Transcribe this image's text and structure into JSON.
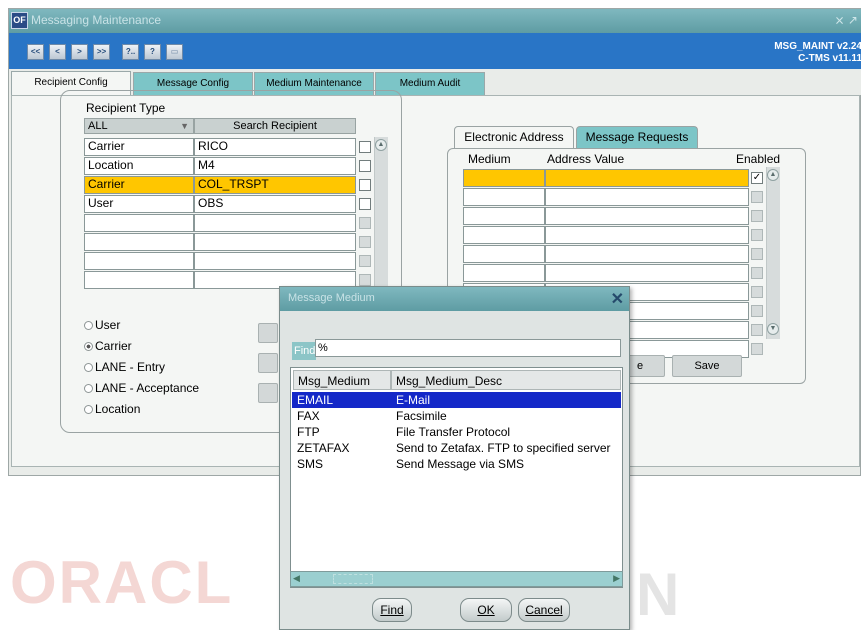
{
  "window": {
    "title": "Messaging Maintenance",
    "icon_label": "OF",
    "controls": "⨯ ↗"
  },
  "toolbar": {
    "buttons": [
      "<<",
      "<",
      ">",
      ">>",
      "?..",
      "?",
      "▭"
    ],
    "app_id": "MSG_MAINT v2.24",
    "version": "C-TMS v11.11"
  },
  "tabs": [
    "Recipient Config",
    "Message Config",
    "Medium Maintenance",
    "Medium Audit"
  ],
  "recipient": {
    "group_label": "Recipient Type",
    "type_filter": "ALL",
    "search_label": "Search Recipient",
    "rows": [
      {
        "type": "Carrier",
        "name": "RICO",
        "selected": false
      },
      {
        "type": "Location",
        "name": "M4",
        "selected": false
      },
      {
        "type": "Carrier",
        "name": "COL_TRSPT",
        "selected": true
      },
      {
        "type": "User",
        "name": "OBS",
        "selected": false
      },
      {
        "type": "",
        "name": "",
        "selected": false
      },
      {
        "type": "",
        "name": "",
        "selected": false
      },
      {
        "type": "",
        "name": "",
        "selected": false
      },
      {
        "type": "",
        "name": "",
        "selected": false
      }
    ],
    "radio_options": [
      {
        "label": "User",
        "checked": false
      },
      {
        "label": "Carrier",
        "checked": true
      },
      {
        "label": "LANE - Entry",
        "checked": false
      },
      {
        "label": "LANE - Acceptance",
        "checked": false
      },
      {
        "label": "Location",
        "checked": false
      }
    ]
  },
  "address": {
    "tabs": [
      "Electronic Address",
      "Message Requests"
    ],
    "columns": [
      "Medium",
      "Address Value",
      "Enabled"
    ],
    "row_count": 10,
    "buttons": [
      "e",
      "Save"
    ]
  },
  "modal": {
    "title": "Message Medium",
    "find_label": "Find",
    "find_value": "%",
    "columns": [
      "Msg_Medium",
      "Msg_Medium_Desc"
    ],
    "rows": [
      {
        "medium": "EMAIL",
        "desc": "E-Mail",
        "selected": true
      },
      {
        "medium": "FAX",
        "desc": "Facsimile",
        "selected": false
      },
      {
        "medium": "FTP",
        "desc": "File Transfer Protocol",
        "selected": false
      },
      {
        "medium": "ZETAFAX",
        "desc": "Send to Zetafax.  FTP to specified server",
        "selected": false
      },
      {
        "medium": "SMS",
        "desc": "Send Message via SMS",
        "selected": false
      }
    ],
    "buttons": {
      "find": "Find",
      "ok": "OK",
      "cancel": "Cancel"
    }
  },
  "watermark": {
    "left": "ORACL",
    "right": "N"
  },
  "colors": {
    "toolbar": "#2975c6",
    "selected_row": "#ffc600",
    "list_selection": "#1428c8",
    "tab_inactive": "#7cc5c7"
  }
}
